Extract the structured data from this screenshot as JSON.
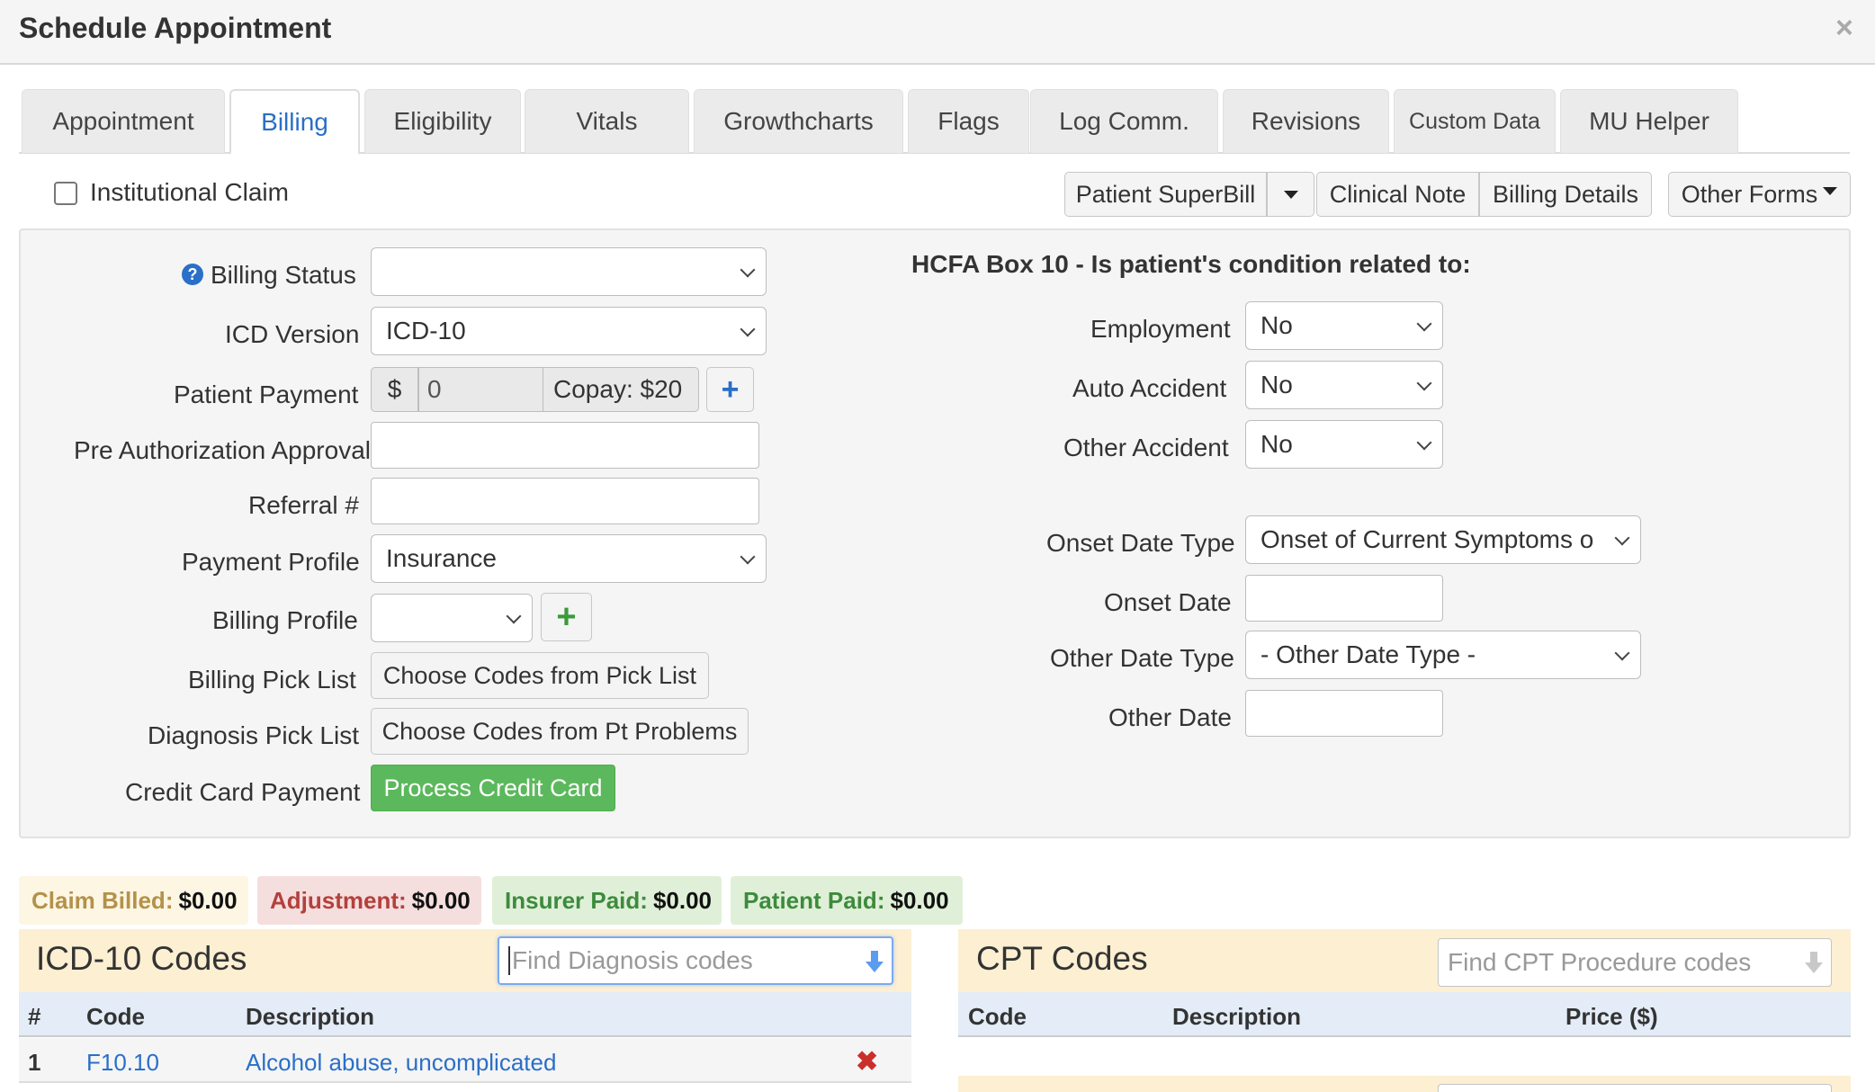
{
  "modal": {
    "title": "Schedule Appointment",
    "close": "×"
  },
  "tabs": [
    {
      "label": "Appointment"
    },
    {
      "label": "Billing"
    },
    {
      "label": "Eligibility"
    },
    {
      "label": "Vitals"
    },
    {
      "label": "Growthcharts"
    },
    {
      "label": "Flags"
    },
    {
      "label": "Log Comm."
    },
    {
      "label": "Revisions"
    },
    {
      "label": "Custom Data"
    },
    {
      "label": "MU Helper"
    }
  ],
  "toolbar": {
    "institutional_claim": "Institutional Claim",
    "superbill": "Patient SuperBill",
    "clinical_note": "Clinical Note",
    "billing_details": "Billing Details",
    "other_forms": "Other Forms"
  },
  "form": {
    "billing_status_label": "Billing Status",
    "billing_status_value": "",
    "icd_version_label": "ICD Version",
    "icd_version_value": "ICD-10",
    "patient_payment_label": "Patient Payment",
    "currency": "$",
    "payment_value": "0",
    "copay": "Copay: $20",
    "pre_auth_label": "Pre Authorization Approval",
    "referral_label": "Referral #",
    "payment_profile_label": "Payment Profile",
    "payment_profile_value": "Insurance",
    "billing_profile_label": "Billing Profile",
    "billing_pick_label": "Billing Pick List",
    "billing_pick_button": "Choose Codes from Pick List",
    "diagnosis_pick_label": "Diagnosis Pick List",
    "diagnosis_pick_button": "Choose Codes from Pt Problems",
    "credit_card_label": "Credit Card Payment",
    "credit_card_button": "Process Credit Card"
  },
  "hcfa": {
    "title": "HCFA Box 10 - Is patient's condition related to:",
    "employment_label": "Employment",
    "employment_value": "No",
    "auto_label": "Auto Accident",
    "auto_value": "No",
    "other_accident_label": "Other Accident",
    "other_accident_value": "No",
    "onset_type_label": "Onset Date Type",
    "onset_type_value": "Onset of Current Symptoms o",
    "onset_date_label": "Onset Date",
    "other_date_type_label": "Other Date Type",
    "other_date_type_value": "- Other Date Type -",
    "other_date_label": "Other Date"
  },
  "summary": {
    "claim_billed_label": "Claim Billed:",
    "claim_billed_value": "$0.00",
    "adjustment_label": "Adjustment:",
    "adjustment_value": "$0.00",
    "insurer_paid_label": "Insurer Paid:",
    "insurer_paid_value": "$0.00",
    "patient_paid_label": "Patient Paid:",
    "patient_paid_value": "$0.00"
  },
  "icd": {
    "title": "ICD-10 Codes",
    "search_placeholder": "Find Diagnosis codes",
    "col_num": "#",
    "col_code": "Code",
    "col_desc": "Description",
    "rows": [
      {
        "num": "1",
        "code": "F10.10",
        "description": "Alcohol abuse, uncomplicated"
      }
    ]
  },
  "cpt": {
    "title": "CPT Codes",
    "search_placeholder": "Find CPT Procedure codes",
    "col_code": "Code",
    "col_desc": "Description",
    "col_price": "Price ($)"
  },
  "colors": {
    "accent": "#2a6fc8",
    "success": "#5cb85c",
    "danger": "#c9302c"
  }
}
